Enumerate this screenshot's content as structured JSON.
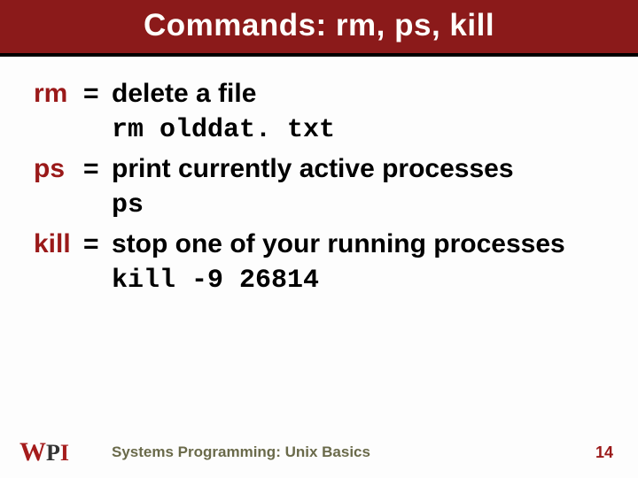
{
  "title": "Commands: rm, ps, kill",
  "items": [
    {
      "cmd": "rm",
      "eq": "=",
      "desc": "delete a file",
      "example": "rm olddat. txt"
    },
    {
      "cmd": "ps",
      "eq": "=",
      "desc": "print currently active processes",
      "example": "ps"
    },
    {
      "cmd": "kill",
      "eq": "=",
      "desc": "stop one of your running processes",
      "example": "kill -9 26814"
    }
  ],
  "footer": {
    "logo": {
      "w": "W",
      "p": "P",
      "i": "I"
    },
    "text": "Systems Programming: Unix Basics",
    "page": "14"
  }
}
